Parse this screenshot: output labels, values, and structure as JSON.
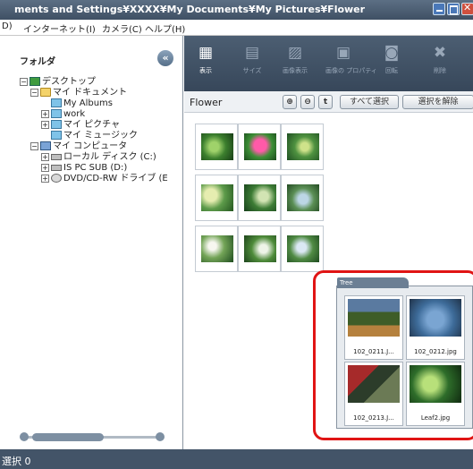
{
  "window": {
    "title": "ments and Settings¥XXXX¥My Documents¥My Pictures¥Flower"
  },
  "menu": [
    "D)",
    "インターネット(I)",
    "カメラ(C)",
    "ヘルプ(H)"
  ],
  "left_panel": {
    "header": "フォルダ",
    "collapse_icon": "«",
    "tree": [
      {
        "label": "デスクトップ",
        "icon": "desktop-icon",
        "expander": "−"
      },
      {
        "label": "マイ ドキュメント",
        "icon": "folder-icon",
        "expander": "−"
      },
      {
        "label": "My Albums",
        "icon": "folder-icon",
        "expander": ""
      },
      {
        "label": "work",
        "icon": "folder-icon",
        "expander": "+"
      },
      {
        "label": "マイ ピクチャ",
        "icon": "folder-icon",
        "expander": "+"
      },
      {
        "label": "マイ ミュージック",
        "icon": "folder-icon",
        "expander": ""
      },
      {
        "label": "マイ コンピュータ",
        "icon": "computer-icon",
        "expander": "−"
      },
      {
        "label": "ローカル ディスク (C:)",
        "icon": "drive-icon",
        "expander": "+"
      },
      {
        "label": "IS PC SUB (D:)",
        "icon": "drive-icon",
        "expander": "+"
      },
      {
        "label": "DVD/CD-RW ドライブ (E",
        "icon": "cd-drive-icon",
        "expander": "+"
      }
    ]
  },
  "toolbar": {
    "buttons": [
      {
        "label": "表示",
        "icon": "view-icon",
        "active": true
      },
      {
        "label": "サイズ",
        "icon": "size-icon",
        "active": false
      },
      {
        "label": "画像表示",
        "icon": "image-view-icon",
        "active": false
      },
      {
        "label": "画像の プロパティ",
        "icon": "properties-icon",
        "active": false
      },
      {
        "label": "回転",
        "icon": "rotate-icon",
        "active": false
      },
      {
        "label": "削除",
        "icon": "delete-icon",
        "active": false
      }
    ]
  },
  "pathbar": {
    "path": "Flower",
    "zoom_in": "⊕",
    "zoom_out": "⊖",
    "up": "t",
    "select_all": "すべて選択",
    "deselect": "選択を解除"
  },
  "tree_popup": {
    "tab_label": "Tree",
    "items": [
      {
        "caption": "102_0211.J..."
      },
      {
        "caption": "102_0212.jpg"
      },
      {
        "caption": "102_0213.J..."
      },
      {
        "caption": "Leaf2.jpg"
      }
    ]
  },
  "status": {
    "text": "選択 0"
  },
  "colors": {
    "toolbar_bg": "#3f4f62",
    "highlight_border": "#e01414",
    "statusbar_bg": "#435468"
  }
}
